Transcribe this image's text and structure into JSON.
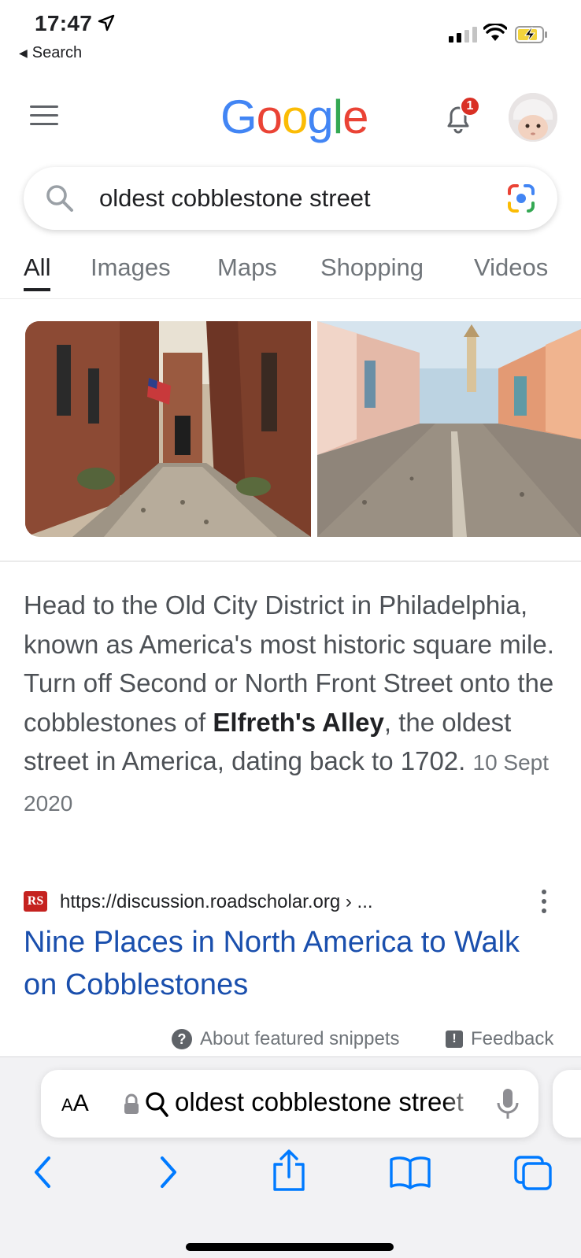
{
  "status_bar": {
    "time": "17:47",
    "back_app": "Search"
  },
  "header": {
    "logo_letters": [
      "G",
      "o",
      "o",
      "g",
      "l",
      "e"
    ],
    "notification_count": "1"
  },
  "search": {
    "query": "oldest cobblestone street"
  },
  "tabs": [
    "All",
    "Images",
    "Maps",
    "Shopping",
    "Videos"
  ],
  "snippet": {
    "text_before": "Head to the Old City District in Philadelphia, known as America's most historic square mile. Turn off Second or North Front Street onto the cobblestones of ",
    "bold": "Elfreth's Alley",
    "text_after": ", the oldest street in America, dating back to 1702.",
    "date": "10 Sept 2020"
  },
  "result": {
    "favicon_text": "RS",
    "url": "https://discussion.roadscholar.org › ...",
    "title": "Nine Places in North America to Walk on Cobblestones"
  },
  "snippet_footer": {
    "about": "About featured snippets",
    "feedback": "Feedback"
  },
  "safari": {
    "aa_small": "A",
    "aa_large": "A",
    "address_text": "oldest cobblestone street"
  },
  "colors": {
    "google_blue": "#4285f4",
    "google_red": "#ea4335",
    "google_yellow": "#fbbc05",
    "google_green": "#34a853",
    "link_blue": "#1a4fad",
    "ios_blue": "#007aff"
  }
}
